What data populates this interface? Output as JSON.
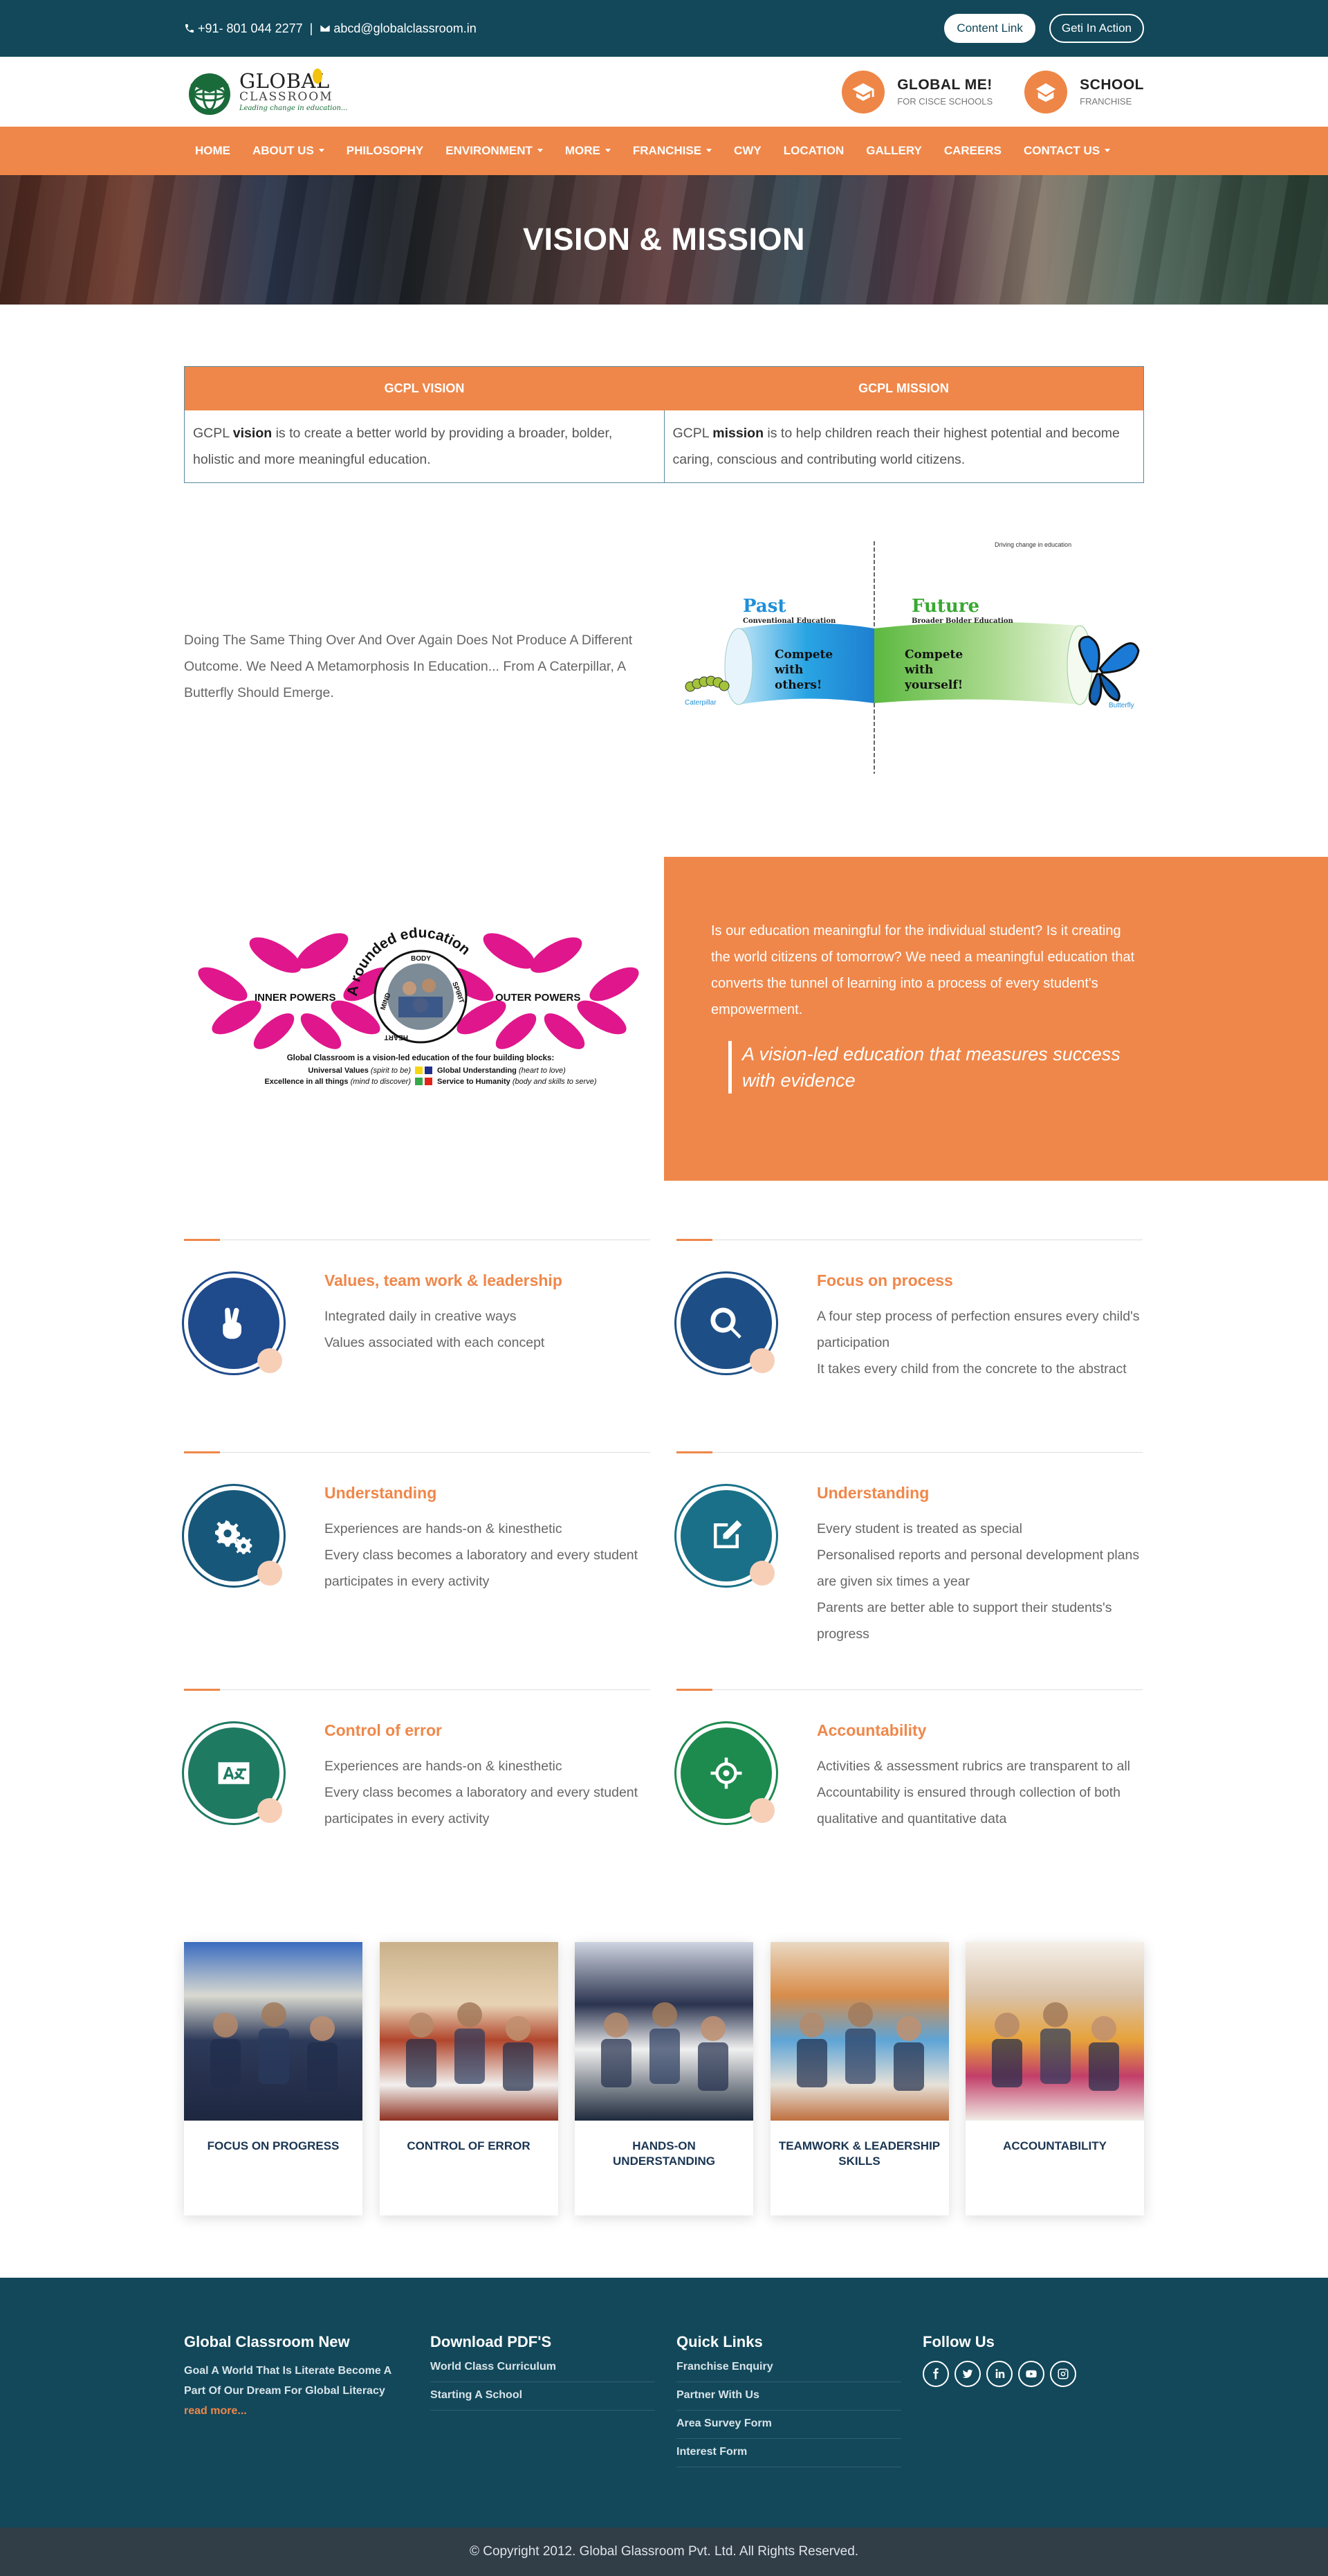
{
  "topbar": {
    "phone": "+91- 801 044 2277",
    "separator": "|",
    "email": "abcd@globalclassroom.in",
    "content_link": "Content Link",
    "geti_in_action": "Geti In Action"
  },
  "header": {
    "logo_line1": "GLOBAL",
    "logo_line2": "CLASSROOM",
    "logo_tagline": "Leading change in education...",
    "items": [
      {
        "title": "GLOBAL ME!",
        "subtitle": "FOR CISCE SCHOOLS",
        "icon": "graduation-cap-icon"
      },
      {
        "title": "SCHOOL",
        "subtitle": "FRANCHISE",
        "icon": "school-icon"
      }
    ]
  },
  "nav": [
    {
      "label": "HOME",
      "dropdown": false
    },
    {
      "label": "ABOUT US",
      "dropdown": true
    },
    {
      "label": "PHILOSOPHY",
      "dropdown": false
    },
    {
      "label": "ENVIRONMENT",
      "dropdown": true
    },
    {
      "label": "MORE",
      "dropdown": true
    },
    {
      "label": "FRANCHISE",
      "dropdown": true
    },
    {
      "label": "CWY",
      "dropdown": false
    },
    {
      "label": "LOCATION",
      "dropdown": false
    },
    {
      "label": "GALLERY",
      "dropdown": false
    },
    {
      "label": "CAREERS",
      "dropdown": false
    },
    {
      "label": "CONTACT US",
      "dropdown": true
    }
  ],
  "hero": {
    "title": "VISION & MISSION"
  },
  "vision_mission": {
    "vision_heading": "GCPL VISION",
    "mission_heading": "GCPL MISSION",
    "vision_prefix": "GCPL ",
    "vision_keyword": "vision",
    "vision_text": " is to create a better world by providing a broader, bolder, holistic and more meaningful education.",
    "mission_prefix": "GCPL ",
    "mission_keyword": "mission",
    "mission_text": " is to help children reach their highest potential and become caring, conscious and contributing world citizens."
  },
  "metamorphosis": {
    "text": "Doing The Same Thing Over And Over Again Does Not Produce A Different Outcome. We Need A Metamorphosis In Education... From A Caterpillar, A Butterfly Should Emerge.",
    "diagram": {
      "top_note": "Driving change in education",
      "past": "Past",
      "past_sub": "Conventional Education",
      "future": "Future",
      "future_sub": "Broader Bolder Education",
      "left_text": "Compete with others!",
      "right_text": "Compete with yourself!",
      "caterpillar": "Caterpillar",
      "butterfly": "Butterfly"
    }
  },
  "rounded": {
    "diagram": {
      "arc_title": "A rounded education",
      "inner": "INNER POWERS",
      "outer": "OUTER POWERS",
      "body": "BODY",
      "mind": "MIND",
      "spirit": "SPIRIT",
      "heart": "HEART",
      "caption1": "Global Classroom is a vision-led education of the four building blocks:",
      "uv": "Universal Values",
      "uv_note": "(spirit to be)",
      "gu": "Global Understanding",
      "gu_note": "(heart to love)",
      "ex": "Excellence in all things",
      "ex_note": "(mind to discover)",
      "sh": "Service to Humanity",
      "sh_note": "(body and skills to serve)"
    },
    "paragraph": "Is our education meaningful for the individual student? Is it creating the world citizens of tomorrow? We need a meaningful education that converts the tunnel of learning into a process of every student's empowerment.",
    "quote": "A vision-led education that measures success with evidence"
  },
  "features": [
    {
      "title": "Values, team work & leadership",
      "lines": [
        "Integrated daily in creative ways",
        "Values associated with each concept"
      ],
      "icon": "peace-hand-icon",
      "color": "#1f4a8c"
    },
    {
      "title": "Focus on process",
      "lines": [
        "A four step process of perfection ensures every child's participation",
        "It takes every child from the concrete to the abstract"
      ],
      "icon": "search-icon",
      "color": "#1d4f86"
    },
    {
      "title": "Understanding",
      "lines": [
        "Experiences are hands-on & kinesthetic",
        "Every class becomes a laboratory and every student participates in every activity"
      ],
      "icon": "gears-icon",
      "color": "#17587a"
    },
    {
      "title": "Understanding",
      "lines": [
        "Every student is treated as special",
        "Personalised reports and personal development plans are given six times a year",
        "Parents are better able to support their students's progress"
      ],
      "icon": "edit-icon",
      "color": "#1a7088"
    },
    {
      "title": "Control of error",
      "lines": [
        "Experiences are hands-on & kinesthetic",
        "Every class becomes a laboratory and every student participates in every activity"
      ],
      "icon": "language-icon",
      "color": "#1f7a62"
    },
    {
      "title": "Accountability",
      "lines": [
        "Activities & assessment rubrics are transparent to all",
        "Accountability is ensured through collection of both qualitative and quantitative data"
      ],
      "icon": "crosshairs-icon",
      "color": "#1d8a4e"
    }
  ],
  "cards": [
    {
      "caption": "FOCUS ON PROGRESS"
    },
    {
      "caption": "CONTROL OF ERROR"
    },
    {
      "caption": "HANDS-ON UNDERSTANDING"
    },
    {
      "caption": "TEAMWORK & LEADERSHIP SKILLS"
    },
    {
      "caption": "ACCOUNTABILITY"
    }
  ],
  "footer": {
    "col1_title": "Global Classroom New",
    "col1_text": "Goal A World That Is Literate Become A Part Of Our Dream For Global Literacy ",
    "col1_link": "read more...",
    "col2_title": "Download PDF'S",
    "col2_links": [
      "World Class Curriculum",
      "Starting A School"
    ],
    "col3_title": "Quick Links",
    "col3_links": [
      "Franchise Enquiry",
      "Partner With Us",
      "Area Survey Form",
      "Interest Form"
    ],
    "col4_title": "Follow Us",
    "social": [
      "facebook-icon",
      "twitter-icon",
      "linkedin-icon",
      "youtube-icon",
      "instagram-icon"
    ]
  },
  "copyright": "© Copyright 2012. Global Glassroom Pvt. Ltd. All Rights Reserved.",
  "colors": {
    "primary": "#12485a",
    "accent": "#ef874a",
    "footer_bottom": "#313d47"
  }
}
